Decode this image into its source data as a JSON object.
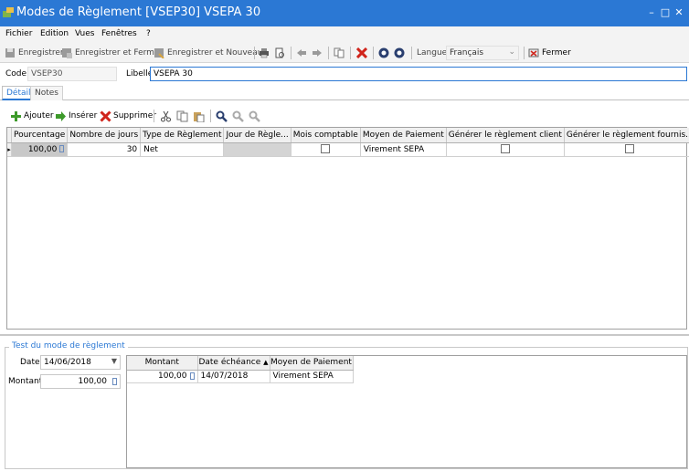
{
  "window": {
    "title": "Modes de Règlement [VSEP30] VSEPA 30",
    "minimize": "–",
    "maximize": "□",
    "close": "✕"
  },
  "menu": [
    "Fichier",
    "Edition",
    "Vues",
    "Fenêtres",
    "?"
  ],
  "toolbar": {
    "save": "Enregistrer",
    "save_close": "Enregistrer et Fermer",
    "save_new": "Enregistrer et Nouveau",
    "language_label": "Langue",
    "language_value": "Français",
    "close": "Fermer"
  },
  "form": {
    "code_label": "Code",
    "code_value": "VSEP30",
    "libelle_label": "Libellé",
    "libelle_value": "VSEPA 30"
  },
  "tabs": [
    "Détail",
    "Notes"
  ],
  "grid_toolbar": {
    "add": "Ajouter",
    "insert": "Insérer",
    "delete": "Supprimer"
  },
  "grid": {
    "columns": [
      "Pourcentage",
      "Nombre de jours",
      "Type de Règlement",
      "Jour de Règle...",
      "Mois comptable",
      "Moyen de Paiement",
      "Générer le règlement client",
      "Générer le règlement fournis..."
    ],
    "rows": [
      {
        "pourcentage": "100,00",
        "jours": "30",
        "type": "Net",
        "jour_reglement": "",
        "mois_comptable": false,
        "moyen": "Virement SEPA",
        "client": false,
        "fournisseur": false
      }
    ]
  },
  "test": {
    "group_title": "Test du mode de règlement",
    "date_label": "Date",
    "date_value": "14/06/2018",
    "montant_label": "Montant",
    "montant_value": "100,00",
    "columns": [
      "Montant",
      "Date échéance",
      "Moyen de Paiement"
    ],
    "rows": [
      {
        "montant": "100,00",
        "echeance": "14/07/2018",
        "moyen": "Virement SEPA"
      }
    ]
  },
  "colors": {
    "titlebar": "#2b78d4",
    "accent": "#2b78d4"
  }
}
